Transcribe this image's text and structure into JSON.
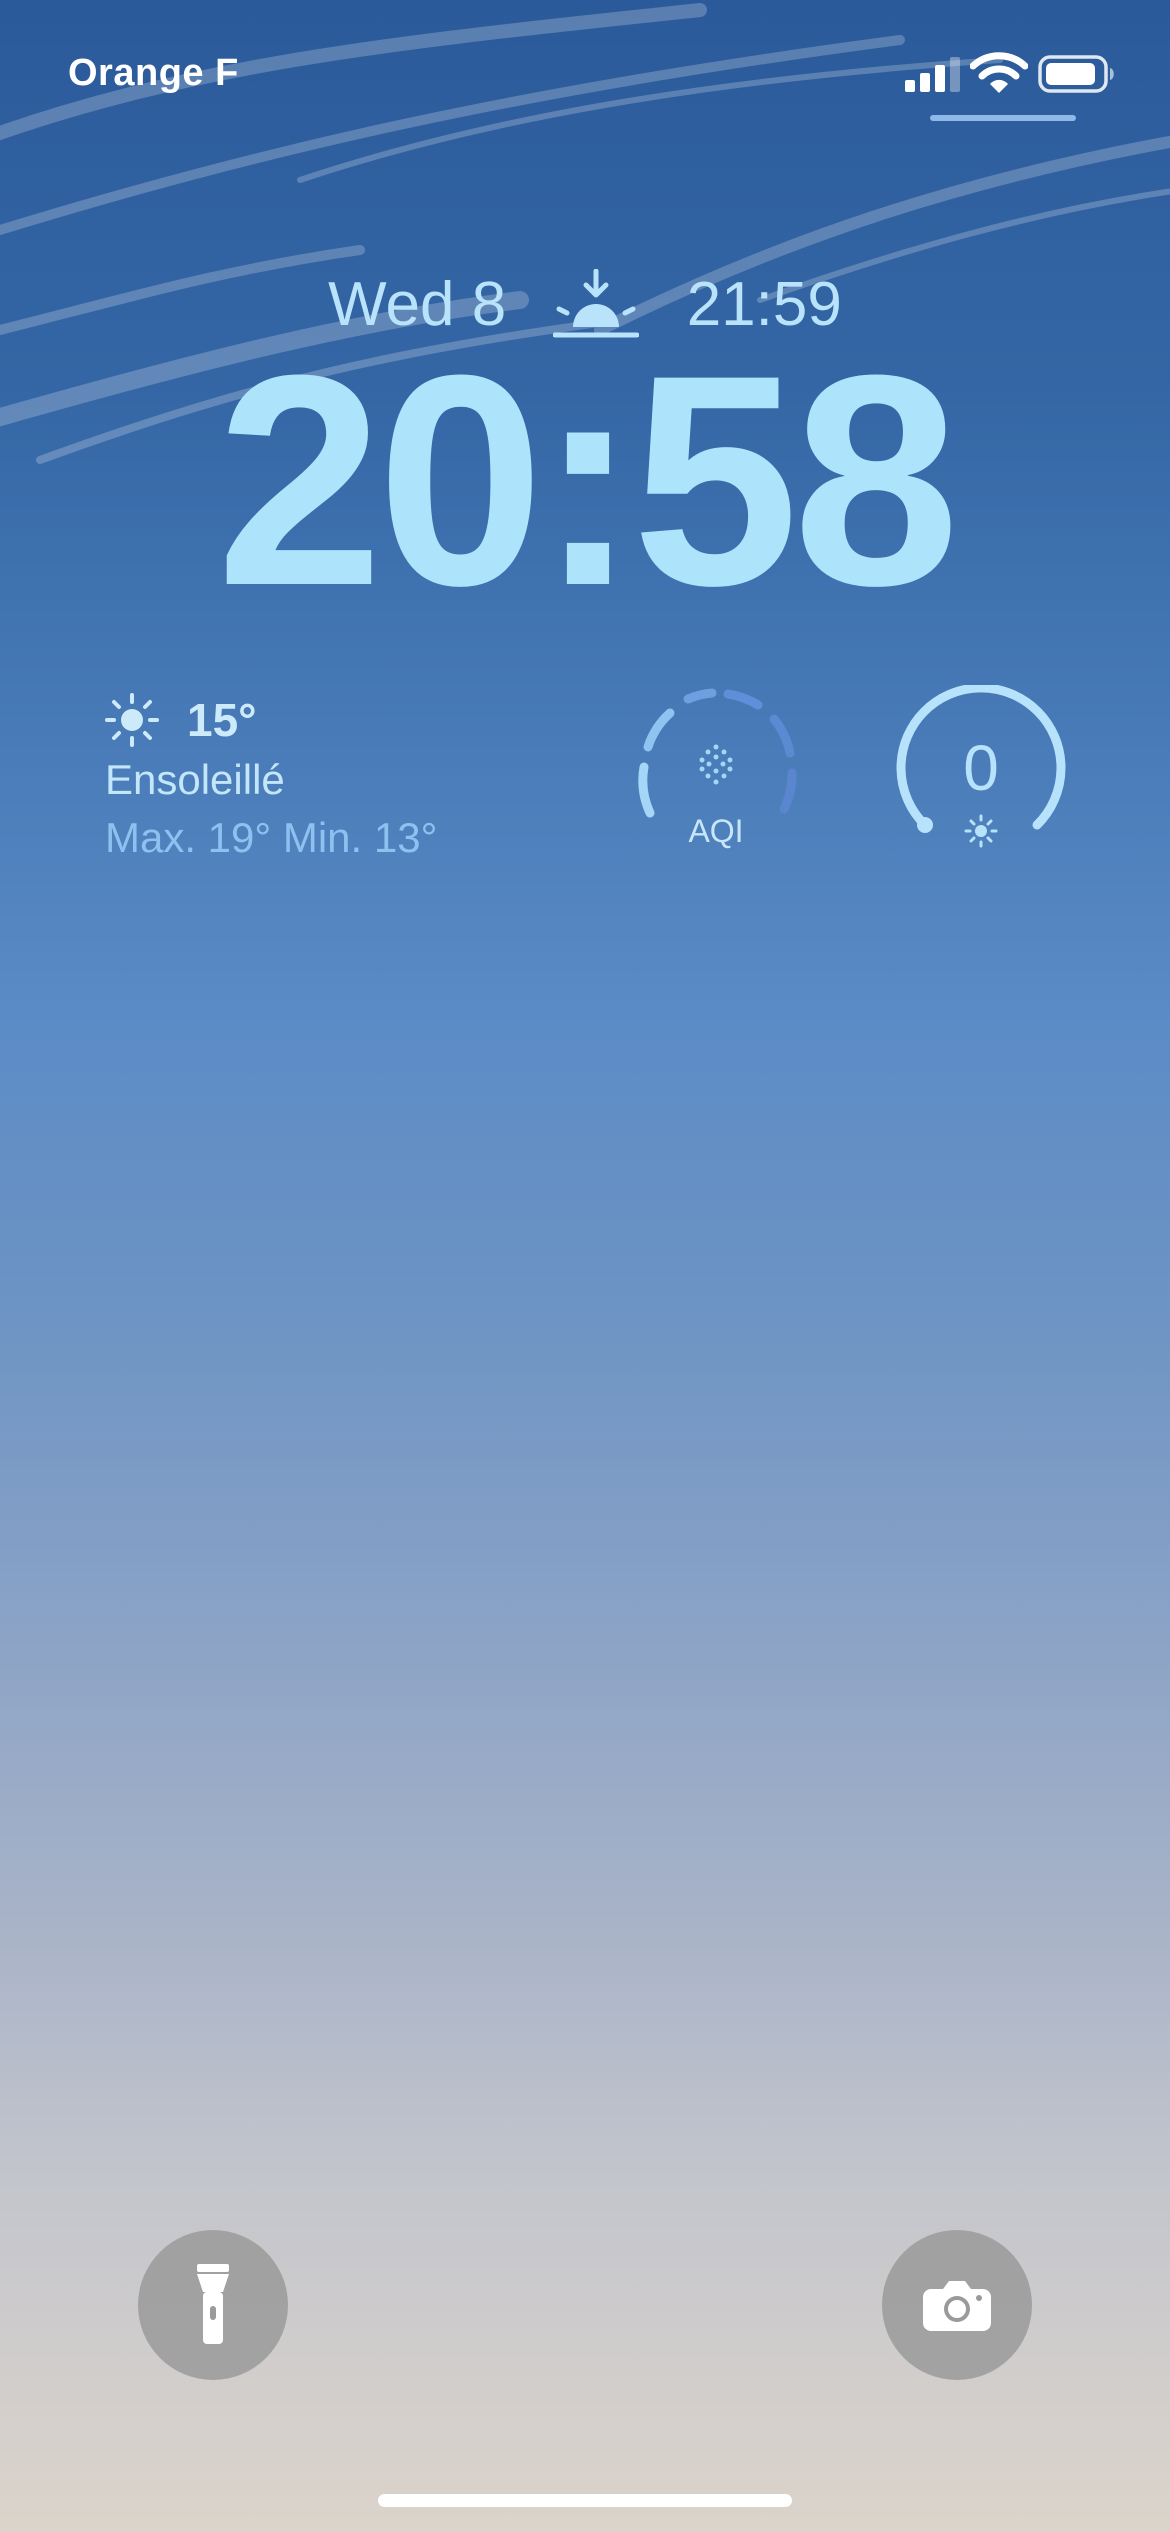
{
  "status_bar": {
    "carrier": "Orange F",
    "signal_bars_active": 3,
    "signal_bars_total": 4,
    "battery_level": 0.9
  },
  "lock_screen": {
    "date": "Wed 8",
    "sunset_time": "21:59",
    "time": "20:58"
  },
  "weather_widget": {
    "temperature": "15°",
    "condition": "Ensoleillé",
    "minmax": "Max. 19° Min. 13°"
  },
  "aqi_widget": {
    "label": "AQI"
  },
  "uv_widget": {
    "value": "0"
  },
  "colors": {
    "text_primary": "#ade4fb",
    "minmax_text": "#8ec0f0",
    "sky_top": "#2b5a9a",
    "sky_bottom": "#dcd4cb",
    "button_bg": "#969696"
  },
  "icons": {
    "weather": "sun-icon",
    "date_row": "sunset-icon",
    "aqi": "aqi-dots-icon",
    "uv": "uv-sun-icon",
    "quick_left": "flashlight-icon",
    "quick_right": "camera-icon"
  }
}
